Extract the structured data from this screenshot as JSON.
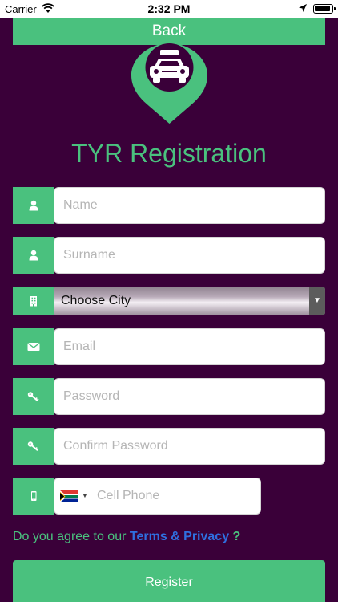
{
  "status_bar": {
    "carrier": "Carrier",
    "time": "2:32 PM"
  },
  "back_button": {
    "label": "Back"
  },
  "title": "TYR Registration",
  "form": {
    "name": {
      "placeholder": "Name",
      "icon": "person-icon"
    },
    "surname": {
      "placeholder": "Surname",
      "icon": "person-icon"
    },
    "city": {
      "selected": "Choose City",
      "icon": "building-icon"
    },
    "email": {
      "placeholder": "Email",
      "icon": "envelope-icon"
    },
    "password": {
      "placeholder": "Password",
      "icon": "key-icon"
    },
    "confirm_password": {
      "placeholder": "Confirm Password",
      "icon": "key-icon"
    },
    "cell_phone": {
      "placeholder": "Cell Phone",
      "icon": "mobile-phone-icon",
      "country_flag": "south-africa-flag"
    }
  },
  "agreement": {
    "prefix": "Do you agree to our",
    "link": "Terms & Privacy",
    "suffix": "?"
  },
  "register_button": {
    "label": "Register"
  },
  "colors": {
    "background": "#3a0039",
    "accent": "#4ac17e",
    "link": "#2f6fe0"
  }
}
